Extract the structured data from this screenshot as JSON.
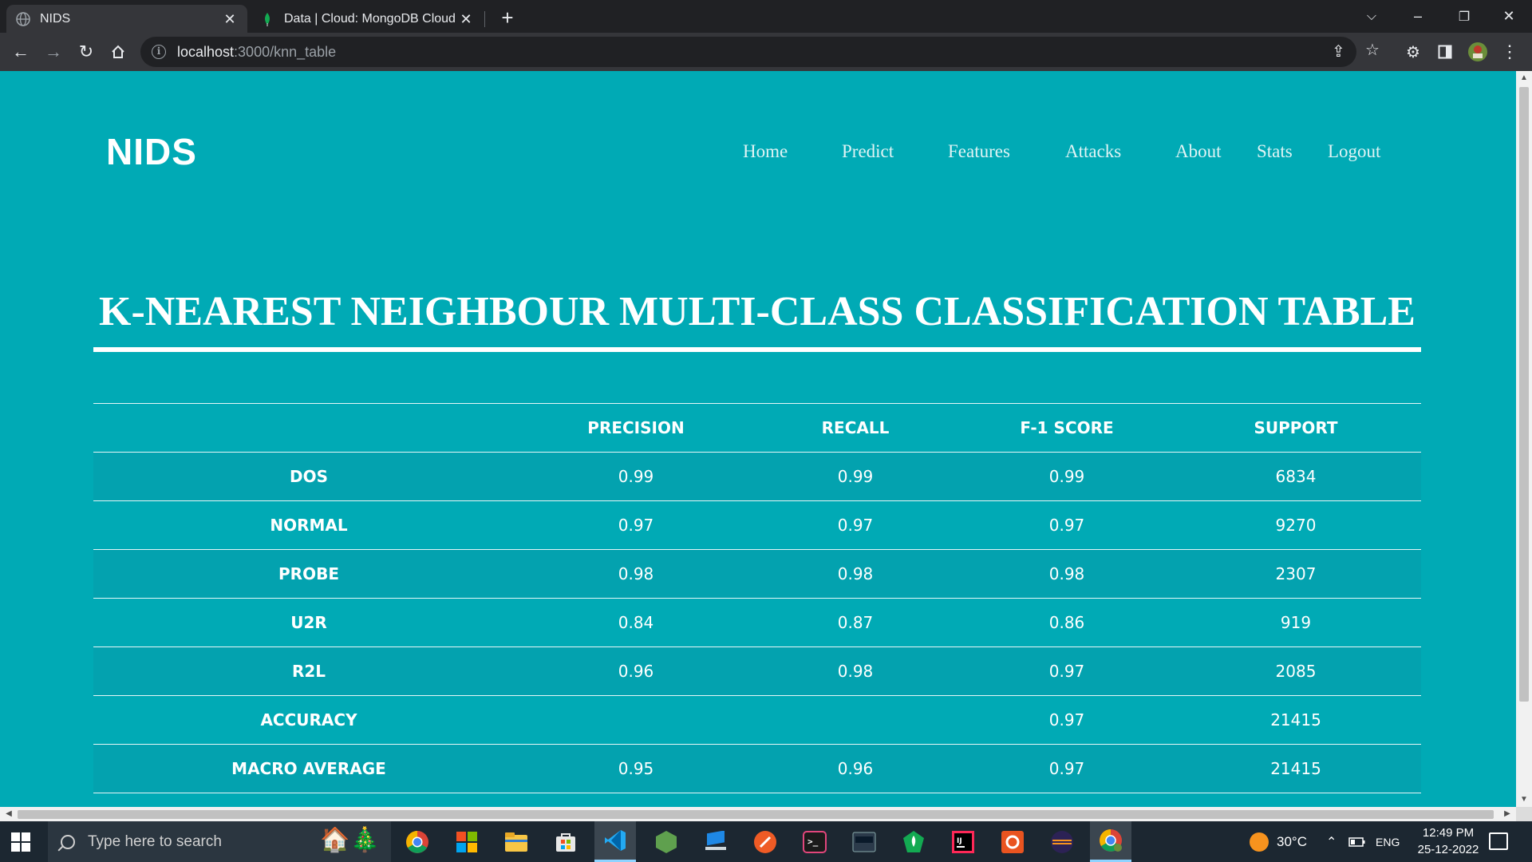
{
  "browser": {
    "tabs": [
      {
        "title": "NIDS",
        "favicon": "globe-icon",
        "active": true
      },
      {
        "title": "Data | Cloud: MongoDB Cloud",
        "favicon": "mongodb-leaf-icon",
        "active": false
      }
    ],
    "url_host": "localhost",
    "url_path": ":3000/knn_table"
  },
  "site": {
    "logo": "NIDS",
    "nav": [
      "Home",
      "Predict",
      "Features",
      "Attacks",
      "About",
      "Stats",
      "Logout"
    ]
  },
  "page": {
    "heading": "K-NEAREST NEIGHBOUR MULTI-CLASS CLASSIFICATION TABLE"
  },
  "table": {
    "headers": [
      "",
      "PRECISION",
      "RECALL",
      "F-1 SCORE",
      "SUPPORT"
    ],
    "rows": [
      [
        "DOS",
        "0.99",
        "0.99",
        "0.99",
        "6834"
      ],
      [
        "NORMAL",
        "0.97",
        "0.97",
        "0.97",
        "9270"
      ],
      [
        "PROBE",
        "0.98",
        "0.98",
        "0.98",
        "2307"
      ],
      [
        "U2R",
        "0.84",
        "0.87",
        "0.86",
        "919"
      ],
      [
        "R2L",
        "0.96",
        "0.98",
        "0.97",
        "2085"
      ],
      [
        "ACCURACY",
        "",
        "",
        "0.97",
        "21415"
      ],
      [
        "MACRO AVERAGE",
        "0.95",
        "0.96",
        "0.97",
        "21415"
      ]
    ]
  },
  "taskbar": {
    "search_placeholder": "Type here to search",
    "weather": "30°C",
    "language": "ENG",
    "time": "12:49 PM",
    "date": "25-12-2022",
    "apps": [
      "chrome-icon",
      "microsoft-365-icon",
      "file-explorer-icon",
      "microsoft-store-icon",
      "vscode-icon",
      "nodejs-icon",
      "azure-data-studio-icon",
      "postman-icon",
      "terminal-icon",
      "mysql-workbench-icon",
      "mongodb-compass-icon",
      "intellij-icon",
      "ubuntu-icon",
      "eclipse-icon",
      "chrome-profile-icon"
    ]
  },
  "colors": {
    "page_bg": "#00aab5",
    "row_stripe": "#03a2af",
    "text": "#ffffff"
  }
}
